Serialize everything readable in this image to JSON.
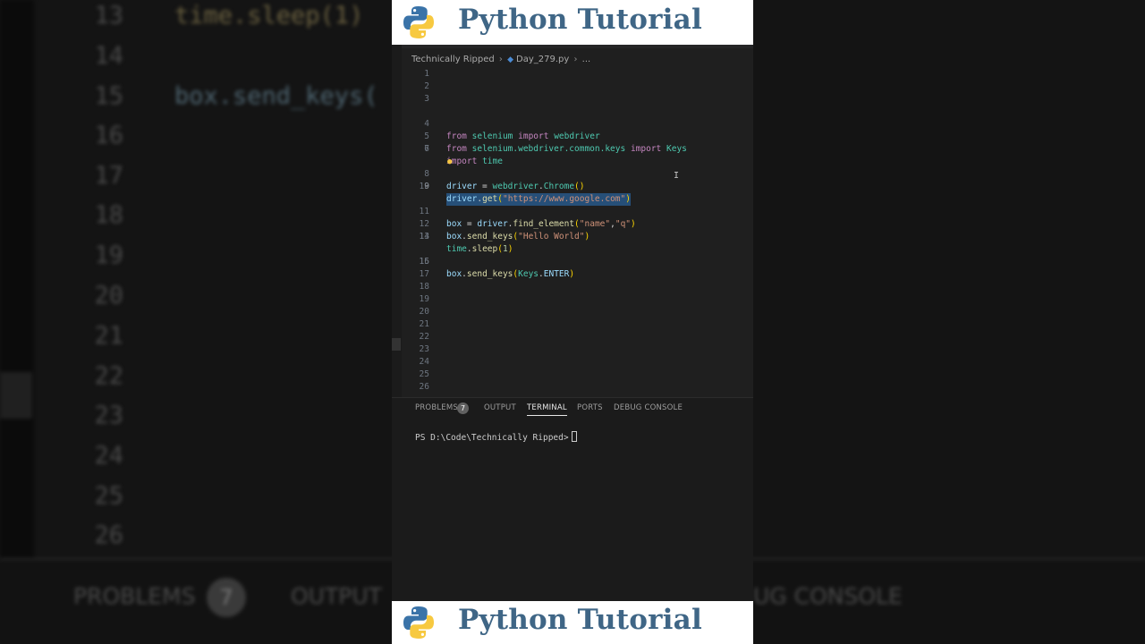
{
  "banner": {
    "title": "Python Tutorial"
  },
  "breadcrumb": {
    "folder": "Technically Ripped",
    "file": "Day_279.py",
    "more": "..."
  },
  "editor": {
    "line_numbers": [
      "1",
      "2",
      "3",
      "4",
      "5",
      "6",
      "7",
      "8",
      "9",
      "10",
      "11",
      "12",
      "13",
      "14",
      "15",
      "16",
      "17",
      "18",
      "19",
      "20",
      "21",
      "22",
      "23",
      "24",
      "25",
      "26"
    ],
    "active_line": "9",
    "code_lines": [
      "",
      "",
      "",
      "from selenium import webdriver",
      "from selenium.webdriver.common.keys import Keys",
      "import time",
      "",
      "driver = webdriver.Chrome()",
      "driver.get(\"https://www.google.com\")",
      "",
      "box = driver.find_element(\"name\",\"q\")",
      "box.send_keys(\"Hello World\")",
      "time.sleep(1)",
      "",
      "box.send_keys(Keys.ENTER)"
    ]
  },
  "panel": {
    "tabs": [
      "PROBLEMS",
      "OUTPUT",
      "TERMINAL",
      "PORTS",
      "DEBUG CONSOLE"
    ],
    "active_tab": "TERMINAL",
    "problems_count": "7",
    "terminal_prompt": "PS D:\\Code\\Technically Ripped>"
  },
  "background": {
    "line_numbers": [
      "13",
      "14",
      "15",
      "16",
      "17",
      "18",
      "19",
      "20",
      "21",
      "22",
      "23",
      "24",
      "25",
      "26"
    ],
    "code_13": "time.sleep(1)",
    "code_15": "box.send_keys(",
    "tabs": [
      "PROBLEMS",
      "OUTPUT",
      "UG CONSOLE"
    ],
    "problems_count": "7"
  },
  "colors": {
    "banner_text": "#3f6686",
    "editor_bg": "#1f1f1f",
    "selection": "#264f78",
    "keyword": "#c586c0",
    "string": "#ce9178"
  }
}
